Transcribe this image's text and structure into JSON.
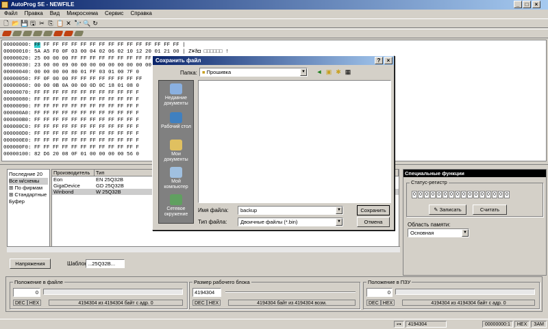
{
  "window": {
    "title": "AutoProg SE - NEWFILE",
    "minimize": "_",
    "maximize": "□",
    "close": "×"
  },
  "menu": [
    "Файл",
    "Правка",
    "Вид",
    "Микросхема",
    "Сервис",
    "Справка"
  ],
  "hex": {
    "rows": [
      {
        "addr": "00000000:",
        "bytes": "FF FF FF FF FF FF FF FF FF FF FF FF FF FF FF FF",
        "ascii": "|"
      },
      {
        "addr": "00000010:",
        "bytes": "5A A5 F0 0F 03 00 04 02 06 02 10 12 20 01 21 00",
        "ascii": "| Z¥ð◘ □□□□□□ !"
      },
      {
        "addr": "00000020:",
        "bytes": "25 00 00 00 FF FF FF FF FF FF FF FF FF FF FF FF",
        "ascii": ""
      },
      {
        "addr": "00000030:",
        "bytes": "23 00 00 09 00 00 00 00 00 00 00 00 00 00 00 00",
        "ascii": ""
      },
      {
        "addr": "00000040:",
        "bytes": "00 00 00 00 80 01 FF 03 01 00 7F 0",
        "ascii": ""
      },
      {
        "addr": "00000050:",
        "bytes": "FF 0F 00 00 FF FF FF FF FF FF FF FF",
        "ascii": ""
      },
      {
        "addr": "00000060:",
        "bytes": "00 00 0B 0A 00 00 0D 0C 18 01 08 0",
        "ascii": ""
      },
      {
        "addr": "00000070:",
        "bytes": "FF FF FF FF FF FF FF FF FF FF FF F",
        "ascii": ""
      },
      {
        "addr": "00000080:",
        "bytes": "FF FF FF FF FF FF FF FF FF FF FF F",
        "ascii": ""
      },
      {
        "addr": "00000090:",
        "bytes": "FF FF FF FF FF FF FF FF FF FF FF F",
        "ascii": ""
      },
      {
        "addr": "000000A0:",
        "bytes": "FF FF FF FF FF FF FF FF FF FF FF F",
        "ascii": ""
      },
      {
        "addr": "000000B0:",
        "bytes": "FF FF FF FF FF FF FF FF FF FF FF F",
        "ascii": ""
      },
      {
        "addr": "000000C0:",
        "bytes": "FF FF FF FF FF FF FF FF FF FF FF F",
        "ascii": ""
      },
      {
        "addr": "000000D0:",
        "bytes": "FF FF FF FF FF FF FF FF FF FF FF F",
        "ascii": ""
      },
      {
        "addr": "000000E0:",
        "bytes": "FF FF FF FF FF FF FF FF FF FF FF F",
        "ascii": ""
      },
      {
        "addr": "000000F0:",
        "bytes": "FF FF FF FF FF FF FF FF FF FF FF F",
        "ascii": ""
      },
      {
        "addr": "00000100:",
        "bytes": "82 D6 20 08 0F 01 00 00 00 00 56 0",
        "ascii": ""
      }
    ]
  },
  "tree": {
    "items": [
      "Последние 20",
      "Все м/схемы",
      "По фирмам",
      "Стандартные",
      "Буфер"
    ]
  },
  "chiplist": {
    "headers": [
      "Производитель",
      "Тип"
    ],
    "rows": [
      {
        "maker": "Eon",
        "type": "EN 25Q32B"
      },
      {
        "maker": "GigaDevice",
        "type": "GD 25Q32B"
      },
      {
        "maker": "Winbond",
        "type": "W 25Q32B"
      }
    ]
  },
  "left_controls": {
    "voltage_button": "Напряжения",
    "template_label": "Шаблон",
    "template_value": "...25Q32B..."
  },
  "special": {
    "title": "Специальные функции",
    "status_label": "Статус-регистр",
    "bits": [
      "0",
      "0",
      "0",
      "0",
      "0",
      "0",
      "0",
      "0",
      "0",
      "0",
      "0",
      "0",
      "0",
      "0",
      "0",
      "0"
    ],
    "write_button": "Записать",
    "read_button": "Считать",
    "mem_area_label": "Область памяти:",
    "mem_area_value": "Основная"
  },
  "bottom": {
    "file_pos": {
      "label": "Положение в файле",
      "value": "0",
      "dec": "DEC",
      "hex": "HEX",
      "info": "4194304 из 4194304 байт с адр. 0"
    },
    "block_size": {
      "label": "Размер рабочего блока",
      "value": "4194304",
      "dec": "DEC",
      "hex": "HEX",
      "info": "4194304 байт из 4194304 возм."
    },
    "rom_pos": {
      "label": "Положение в ПЗУ",
      "value": "0",
      "dec": "DEC",
      "hex": "HEX",
      "info": "4194304 из 4194304 байт с адр. 0"
    }
  },
  "statusbar": {
    "size": "4194304",
    "counter": "00000000:1",
    "mode1": "HEX",
    "mode2": "ЗАМ"
  },
  "dialog": {
    "title": "Сохранить файл",
    "help": "?",
    "close": "×",
    "folder_label": "Папка:",
    "folder_value": "Прошивка",
    "places": [
      "Недавние документы",
      "Рабочий стол",
      "Мои документы",
      "Мой компьютер",
      "Сетевое окружение"
    ],
    "filename_label": "Имя файла:",
    "filename_value": "backup",
    "filetype_label": "Тип файла:",
    "filetype_value": "Двоичные файлы (*.bin)",
    "save_button": "Сохранить",
    "cancel_button": "Отмена"
  }
}
